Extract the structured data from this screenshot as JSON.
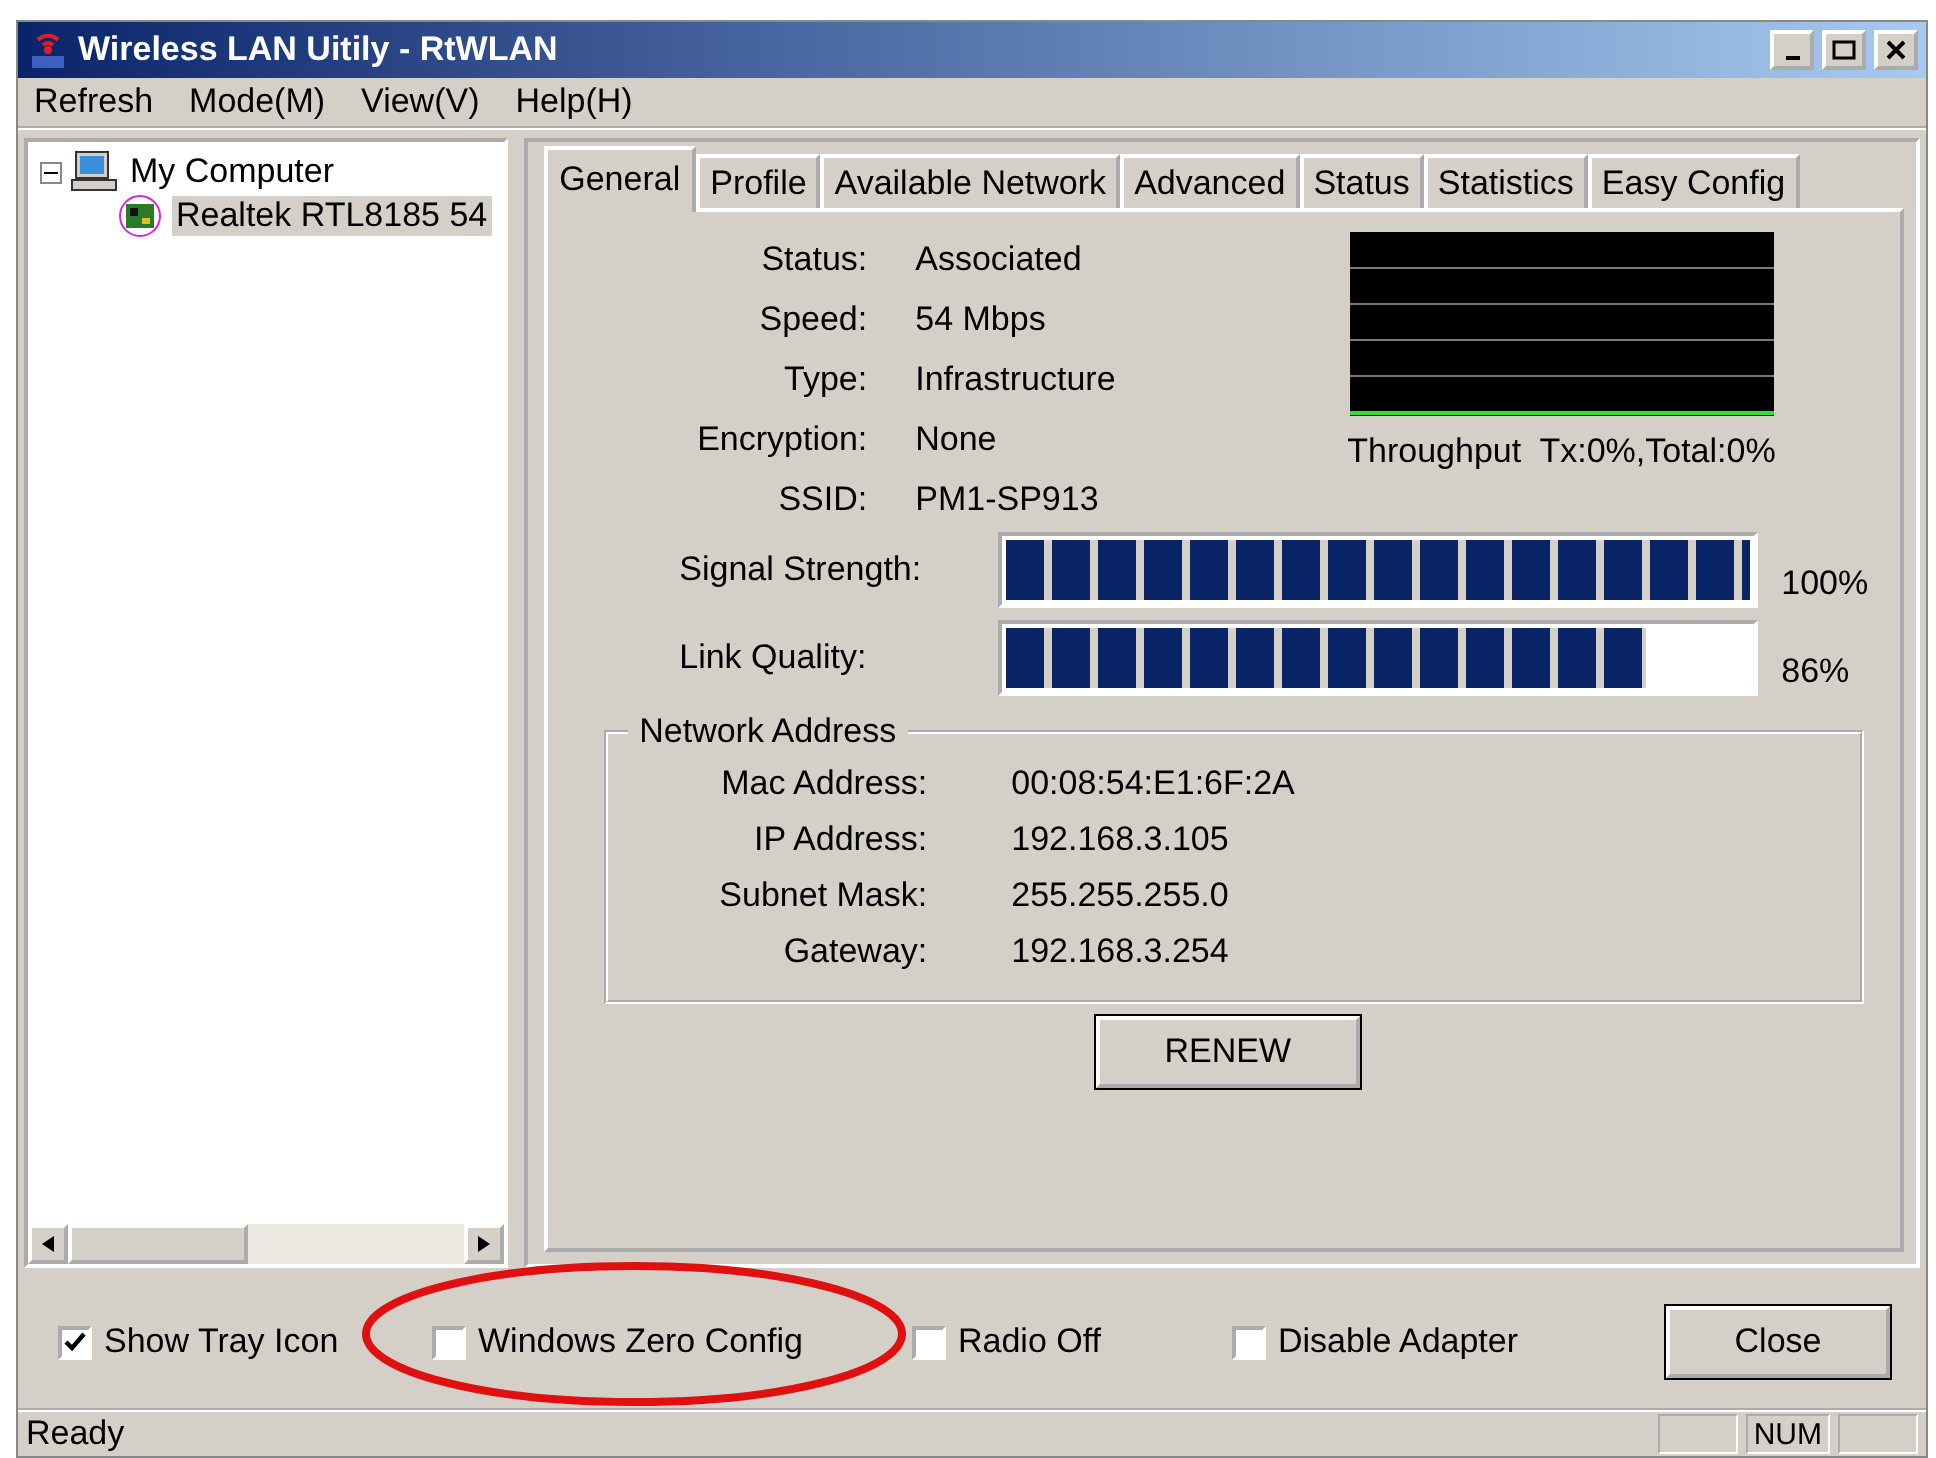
{
  "window": {
    "title": "Wireless LAN Uitily - RtWLAN"
  },
  "menu": [
    "Refresh",
    "Mode(M)",
    "View(V)",
    "Help(H)"
  ],
  "tree": [
    {
      "label": "My Computer",
      "expanded": true,
      "children": [
        {
          "label": "Realtek RTL8185 54",
          "selected": true
        }
      ]
    }
  ],
  "tabs": [
    {
      "label": "General",
      "selected": true
    },
    {
      "label": "Profile",
      "selected": false
    },
    {
      "label": "Available Network",
      "selected": false
    },
    {
      "label": "Advanced",
      "selected": false
    },
    {
      "label": "Status",
      "selected": false
    },
    {
      "label": "Statistics",
      "selected": false
    },
    {
      "label": "Easy Config",
      "selected": false
    }
  ],
  "info": [
    {
      "label": "Status:",
      "value": "Associated"
    },
    {
      "label": "Speed:",
      "value": "54 Mbps"
    },
    {
      "label": "Type:",
      "value": "Infrastructure"
    },
    {
      "label": "Encryption:",
      "value": "None"
    },
    {
      "label": "SSID:",
      "value": "PM1-SP913"
    }
  ],
  "throughput": "Throughput  Tx:0%,Total:0%",
  "meters": [
    {
      "label": "Signal Strength:",
      "level": 1,
      "reading": "100%"
    },
    {
      "label": "Link Quality:",
      "level": 0.86,
      "reading": "86%"
    }
  ],
  "network_address": {
    "title": "Network Address",
    "fields": [
      {
        "label": "Mac Address:",
        "value": "00:08:54:E1:6F:2A"
      },
      {
        "label": "IP Address:",
        "value": "192.168.3.105"
      },
      {
        "label": "Subnet Mask:",
        "value": "255.255.255.0"
      },
      {
        "label": "Gateway:",
        "value": "192.168.3.254"
      }
    ]
  },
  "renew_button": "RENEW",
  "options": [
    {
      "label": "Show Tray Icon",
      "checked": true
    },
    {
      "label": "Windows Zero Config",
      "checked": false
    },
    {
      "label": "Radio Off",
      "checked": false
    },
    {
      "label": "Disable Adapter",
      "checked": false
    }
  ],
  "close_button": "Close",
  "status_bar": {
    "text": "Ready",
    "indicator": "NUM"
  }
}
